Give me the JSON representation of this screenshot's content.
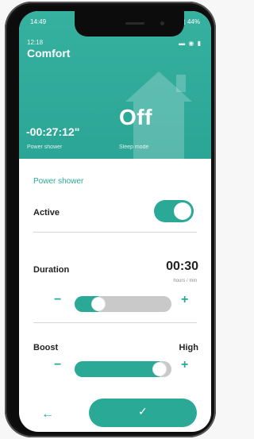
{
  "outer_status": {
    "time": "14:49",
    "icons_left": "⊕ P\\",
    "icons_right": "⌘ ▯ 44%"
  },
  "app": {
    "time": "12:18",
    "status_icons": "▬ ◉ ▮",
    "title": "Comfort"
  },
  "hero": {
    "sleep_value": "Off",
    "timer": "-00:27:12\"",
    "timer_label": "Power shower",
    "sleep_label": "Sleep mode"
  },
  "settings": {
    "section_title": "Power shower",
    "active_label": "Active",
    "active_on": true,
    "duration_label": "Duration",
    "duration_value": "00:30",
    "duration_unit": "hours / min",
    "boost_label": "Boost",
    "boost_value": "High",
    "duration_level": 0.2,
    "boost_level": 0.95
  },
  "controls": {
    "minus": "−",
    "plus": "+",
    "back": "←",
    "check": "✓"
  },
  "colors": {
    "accent": "#2aa997",
    "track": "#c9c9c9"
  }
}
